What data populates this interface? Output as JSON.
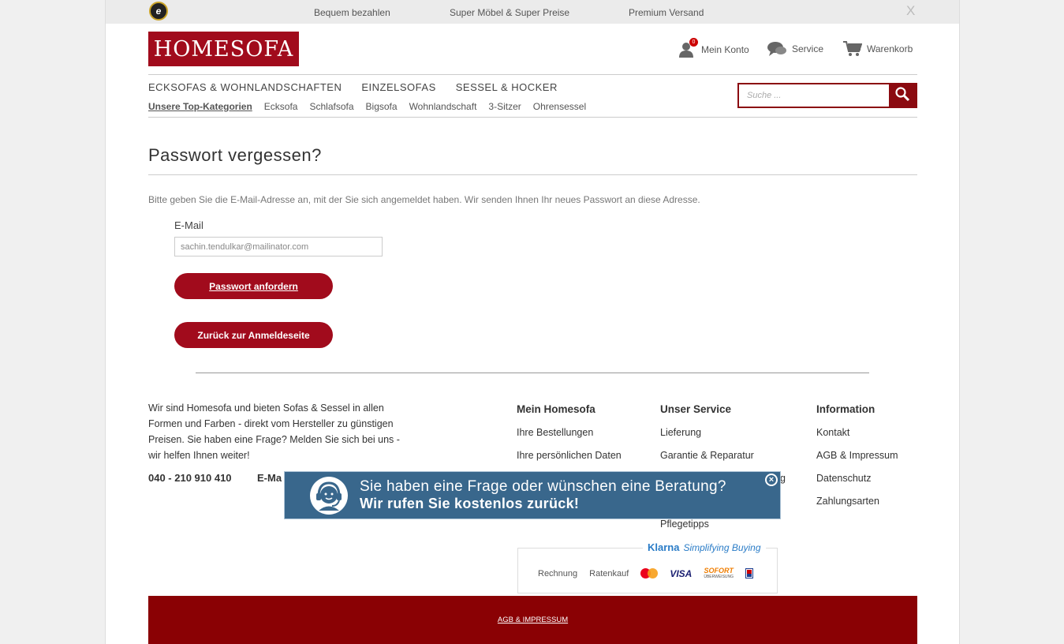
{
  "topbar": {
    "items": [
      "Bequem bezahlen",
      "Super Möbel & Super Preise",
      "Premium Versand"
    ],
    "close_label": "X",
    "seal_letter": "e"
  },
  "header": {
    "logo_text": "HOMESOFA",
    "account_label": "Mein Konto",
    "account_badge": "0",
    "service_label": "Service",
    "cart_label": "Warenkorb"
  },
  "nav": {
    "main": [
      "ECKSOFAS & WOHNLANDSCHAFTEN",
      "EINZELSOFAS",
      "SESSEL & HOCKER"
    ],
    "sub_active": "Unsere Top-Kategorien",
    "sub": [
      "Ecksofa",
      "Schlafsofa",
      "Bigsofa",
      "Wohnlandschaft",
      "3-Sitzer",
      "Ohrensessel"
    ]
  },
  "search": {
    "placeholder": "Suche ..."
  },
  "content": {
    "title": "Passwort vergessen?",
    "intro": "Bitte geben Sie die E-Mail-Adresse an, mit der Sie sich angemeldet haben. Wir senden Ihnen Ihr neues Passwort an diese Adresse.",
    "email_label": "E-Mail",
    "email_value": "sachin.tendulkar@mailinator.com",
    "submit_label": "Passwort anfordern",
    "back_label": "Zurück zur Anmeldeseite"
  },
  "footer": {
    "about": "Wir sind Homesofa und bieten Sofas & Sessel in allen Formen und Farben - direkt vom Hersteller zu günstigen Preisen. Sie haben eine Frage? Melden Sie sich bei uns - wir helfen Ihnen weiter!",
    "phone": "040 - 210 910 410",
    "email_prefix": "E-Ma",
    "columns": [
      {
        "title": "Mein Homesofa",
        "items": [
          "Ihre Bestellungen",
          "Ihre persönlichen Daten"
        ]
      },
      {
        "title": "Unser Service",
        "items": [
          "Lieferung",
          "Garantie & Reparatur",
          "g",
          "",
          "Pflegetipps"
        ]
      },
      {
        "title": "Information",
        "items": [
          "Kontakt",
          "AGB & Impressum",
          "Datenschutz",
          "Zahlungsarten"
        ]
      }
    ],
    "klarna": {
      "brand": "Klarna",
      "tagline": "Simplifying Buying",
      "methods": [
        "Rechnung",
        "Ratenkauf"
      ],
      "visa": "VISA",
      "sofort": "SOFORT",
      "sofort_sub": "ÜBERWEISUNG"
    },
    "bottom_link": "AGB & IMPRESSUM"
  },
  "callback": {
    "line1": "Sie haben eine Frage oder wünschen eine Beratung?",
    "line2": "Wir rufen Sie kostenlos zurück!",
    "close_label": "×"
  },
  "colors": {
    "brand_red": "#a10b1c",
    "footer_red": "#8a0104",
    "callback_blue": "#39678c"
  }
}
